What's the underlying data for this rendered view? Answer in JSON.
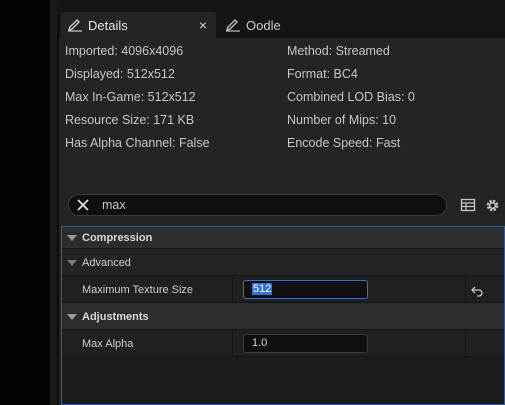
{
  "tabs": [
    {
      "label": "Details",
      "active": true
    },
    {
      "label": "Oodle",
      "active": false
    }
  ],
  "tab_close_glyph": "×",
  "info": {
    "left": [
      "Imported: 4096x4096",
      "Displayed: 512x512",
      "Max In-Game: 512x512",
      "Resource Size: 171 KB",
      "Has Alpha Channel: False"
    ],
    "right": [
      "Method: Streamed",
      "Format: BC4",
      "Combined LOD Bias: 0",
      "Number of Mips: 10",
      "Encode Speed: Fast"
    ]
  },
  "search": {
    "value": "max",
    "clear_icon": "close-x-icon"
  },
  "toolbar_icons": [
    "table-view-icon",
    "gear-icon"
  ],
  "details": {
    "compression": {
      "label": "Compression"
    },
    "advanced": {
      "label": "Advanced"
    },
    "max_texture_size": {
      "label": "Maximum Texture Size",
      "value": "512"
    },
    "adjustments": {
      "label": "Adjustments"
    },
    "max_alpha": {
      "label": "Max Alpha",
      "value": "1.0"
    }
  },
  "colors": {
    "focus": "#2f73d6",
    "panel": "#242424",
    "background": "#151515"
  }
}
